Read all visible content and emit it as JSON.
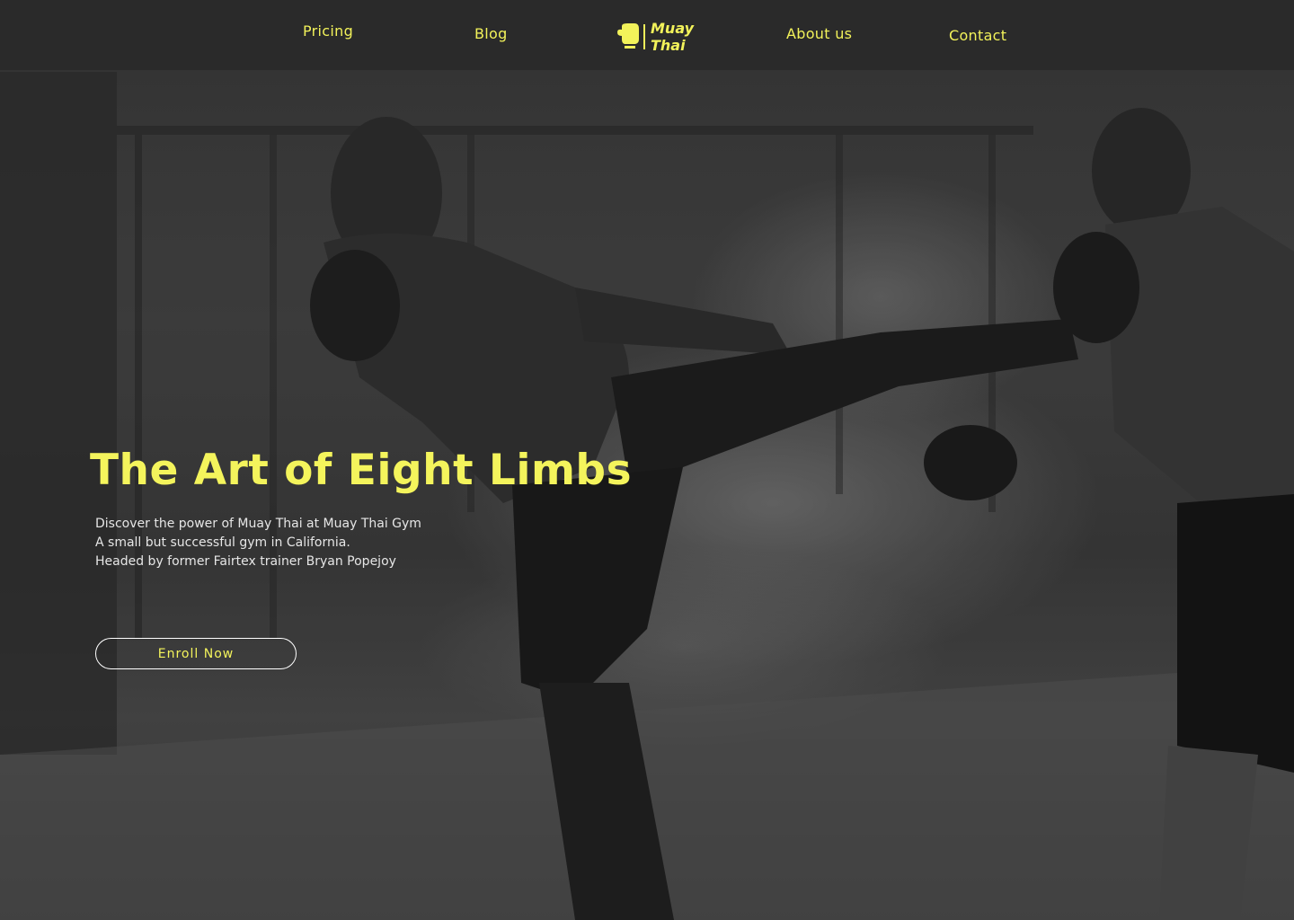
{
  "nav": {
    "links": [
      {
        "label": "Pricing"
      },
      {
        "label": "Blog"
      },
      {
        "label": "About us"
      },
      {
        "label": "Contact"
      }
    ],
    "logo": {
      "line1": "Muay",
      "line2": "Thai",
      "icon": "boxing-glove-icon"
    }
  },
  "hero": {
    "title": "The Art of Eight Limbs",
    "description": [
      "Discover the power of Muay Thai at Muay Thai Gym",
      "A small but successful gym in California.",
      "Headed by former Fairtex trainer Bryan Popejoy"
    ],
    "cta_label": "Enroll Now",
    "background_image": "two-fighters-sparring-photo"
  },
  "colors": {
    "accent": "#f4f45c",
    "nav_background": "#282828",
    "text_light": "#e6e6e6"
  }
}
